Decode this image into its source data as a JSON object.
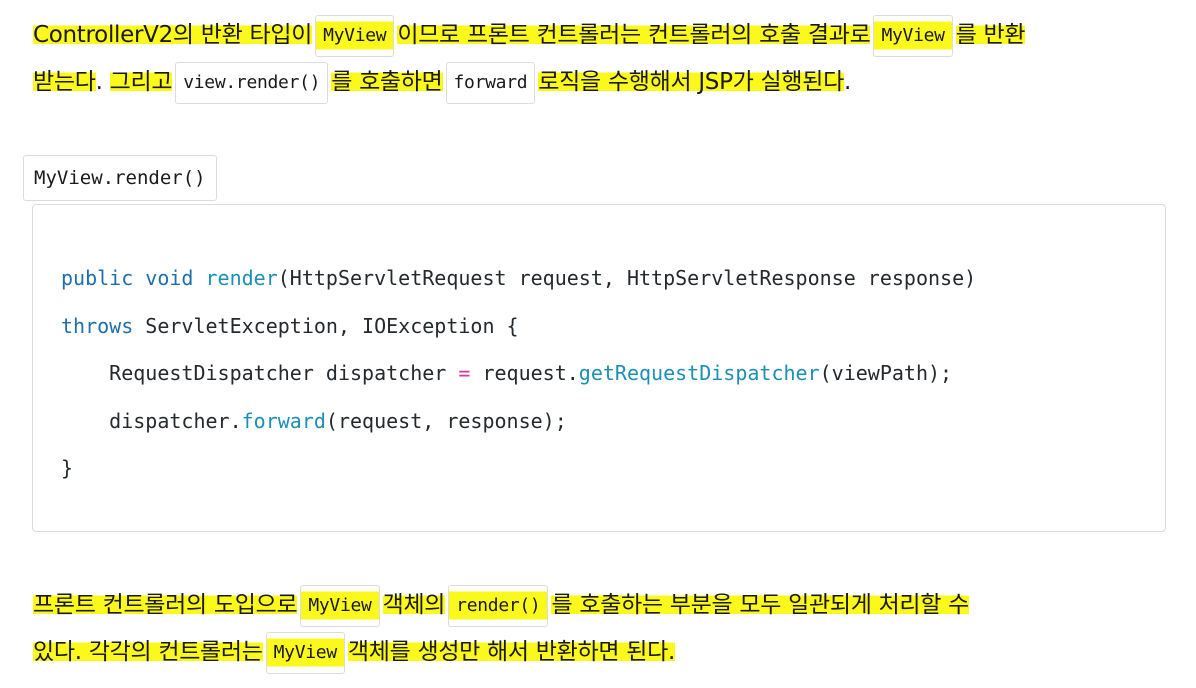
{
  "intro": {
    "line1_a": "ControllerV2의 반환 타입이",
    "line1_code1": "MyView",
    "line1_b": "이므로 프론트 컨트롤러는 컨트롤러의 호출 결과로",
    "line1_code2": "MyView",
    "line1_c": "를 반환",
    "line2_a": "받는다",
    "line2_b": ". ",
    "line2_c": "그리고",
    "line2_code1": "view.render()",
    "line2_d": "를 호출하면",
    "line2_code2": "forward",
    "line2_e": "로직을 수행해서 JSP가 실행된다",
    "line2_f": "."
  },
  "caption": "MyView.render()",
  "code": {
    "l1_kw1": "public",
    "l1_kw2": "void",
    "l1_fn": "render",
    "l1_rest": "(HttpServletRequest request, HttpServletResponse response)",
    "l2_kw": "throws",
    "l2_rest": " ServletException, IOException {",
    "l3_a": "    RequestDispatcher dispatcher ",
    "l3_op": "=",
    "l3_b": " request.",
    "l3_fn": "getRequestDispatcher",
    "l3_c": "(viewPath);",
    "l4_a": "    dispatcher.",
    "l4_fn": "forward",
    "l4_b": "(request, response);",
    "l5": "}"
  },
  "outro": {
    "line1_a": "프론트 컨트롤러의 도입으로",
    "line1_code1": "MyView",
    "line1_b": "객체의",
    "line1_code2": "render()",
    "line1_c": "를 호출하는 부분을 모두 일관되게 처리할 수",
    "line2_a": "있다. 각각의 컨트롤러는",
    "line2_code1": "MyView",
    "line2_b": "객체를 생성만 해서 반환하면 된다."
  },
  "colors": {
    "highlight": "#fbf91c",
    "keyword": "#1f6fa8",
    "function": "#1b8fb5",
    "operator": "#d73a9b"
  }
}
